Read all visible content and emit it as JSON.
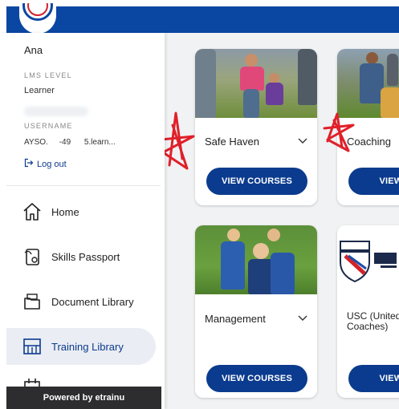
{
  "sidebar": {
    "user_name": "Ana",
    "lms_level_label": "LMS LEVEL",
    "lms_level_value": "Learner",
    "username_label": "USERNAME",
    "username_value": "AYSO.     -49      5.learn...",
    "logout_label": "Log out",
    "nav": [
      {
        "label": "Home",
        "icon": "home-icon"
      },
      {
        "label": "Skills Passport",
        "icon": "skills-passport-icon"
      },
      {
        "label": "Document Library",
        "icon": "document-library-icon"
      },
      {
        "label": "Training Library",
        "icon": "training-library-icon",
        "active": true
      }
    ],
    "footer": "Powered by etrainu"
  },
  "courses": [
    {
      "title": "Safe Haven",
      "button": "VIEW COURSES"
    },
    {
      "title": "Coaching",
      "button": "VIEW CO"
    },
    {
      "title": "Management",
      "button": "VIEW COURSES"
    },
    {
      "title": "USC (United Soccer Coaches)",
      "button": "VIEW CO"
    }
  ],
  "colors": {
    "brand_blue": "#0a47a3",
    "button_blue": "#0b3b8e",
    "footer_dark": "#2d2d30",
    "annotation_red": "#e0202a"
  }
}
